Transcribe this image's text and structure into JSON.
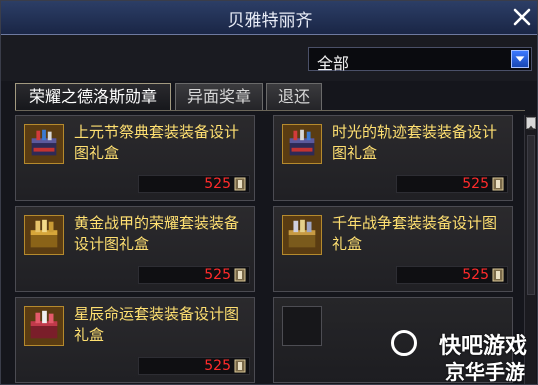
{
  "window": {
    "title": "贝雅特丽齐"
  },
  "filter": {
    "selected": "全部"
  },
  "tabs": [
    {
      "label": "荣耀之德洛斯勋章"
    },
    {
      "label": "异面奖章"
    },
    {
      "label": "退还"
    }
  ],
  "items": [
    {
      "name": "上元节祭典套装装备设计图礼盒",
      "price": "525",
      "icon": "gift-box-icon"
    },
    {
      "name": "时光的轨迹套装装备设计图礼盒",
      "price": "525",
      "icon": "gift-box-icon"
    },
    {
      "name": "黄金战甲的荣耀套装装备设计图礼盒",
      "price": "525",
      "icon": "gift-box-icon"
    },
    {
      "name": "千年战争套装装备设计图礼盒",
      "price": "525",
      "icon": "gift-box-icon"
    },
    {
      "name": "星辰命运套装装备设计图礼盒",
      "price": "525",
      "icon": "gift-box-icon"
    }
  ],
  "watermark": {
    "line1": "快吧游戏",
    "line2": "京华手游"
  },
  "colors": {
    "titlebar": "#2c3e66",
    "item_name": "#ffe071",
    "price": "#ff2b2b",
    "dropdown_arrow": "#3d79ff"
  }
}
